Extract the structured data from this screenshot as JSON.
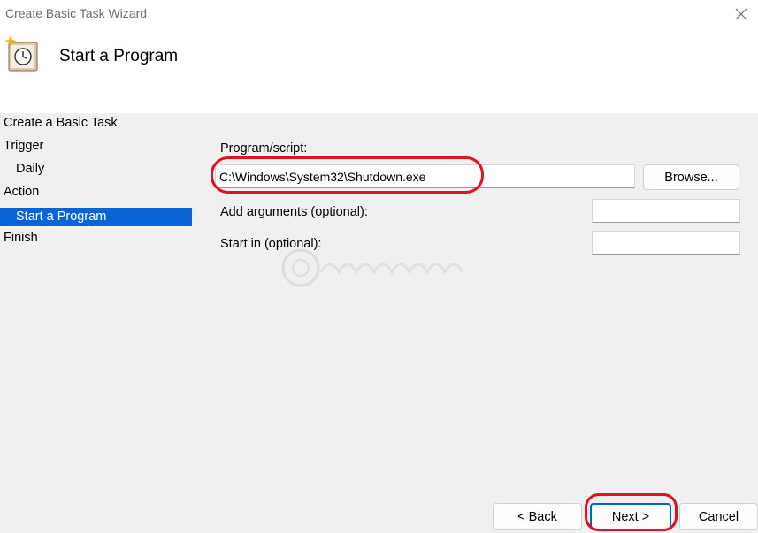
{
  "window": {
    "title": "Create Basic Task Wizard",
    "close_icon": "close-icon"
  },
  "header": {
    "icon": "task-scheduler-clock-icon",
    "title": "Start a Program"
  },
  "sidebar": {
    "steps": [
      {
        "label": "Create a Basic Task",
        "sub": false,
        "active": false
      },
      {
        "label": "Trigger",
        "sub": false,
        "active": false
      },
      {
        "label": "Daily",
        "sub": true,
        "active": false
      },
      {
        "label": "Action",
        "sub": false,
        "active": false
      },
      {
        "label": "Start a Program",
        "sub": true,
        "active": true
      },
      {
        "label": "Finish",
        "sub": false,
        "active": false
      }
    ],
    "active_color": "#0a64d6"
  },
  "form": {
    "program_label": "Program/script:",
    "program_value": "C:\\Windows\\System32\\Shutdown.exe",
    "browse_label": "Browse...",
    "arguments_label": "Add arguments (optional):",
    "arguments_value": "",
    "start_in_label": "Start in (optional):",
    "start_in_value": ""
  },
  "footer": {
    "back_label": "< Back",
    "next_label": "Next >",
    "cancel_label": "Cancel"
  },
  "annotation_color": "#e3101e"
}
